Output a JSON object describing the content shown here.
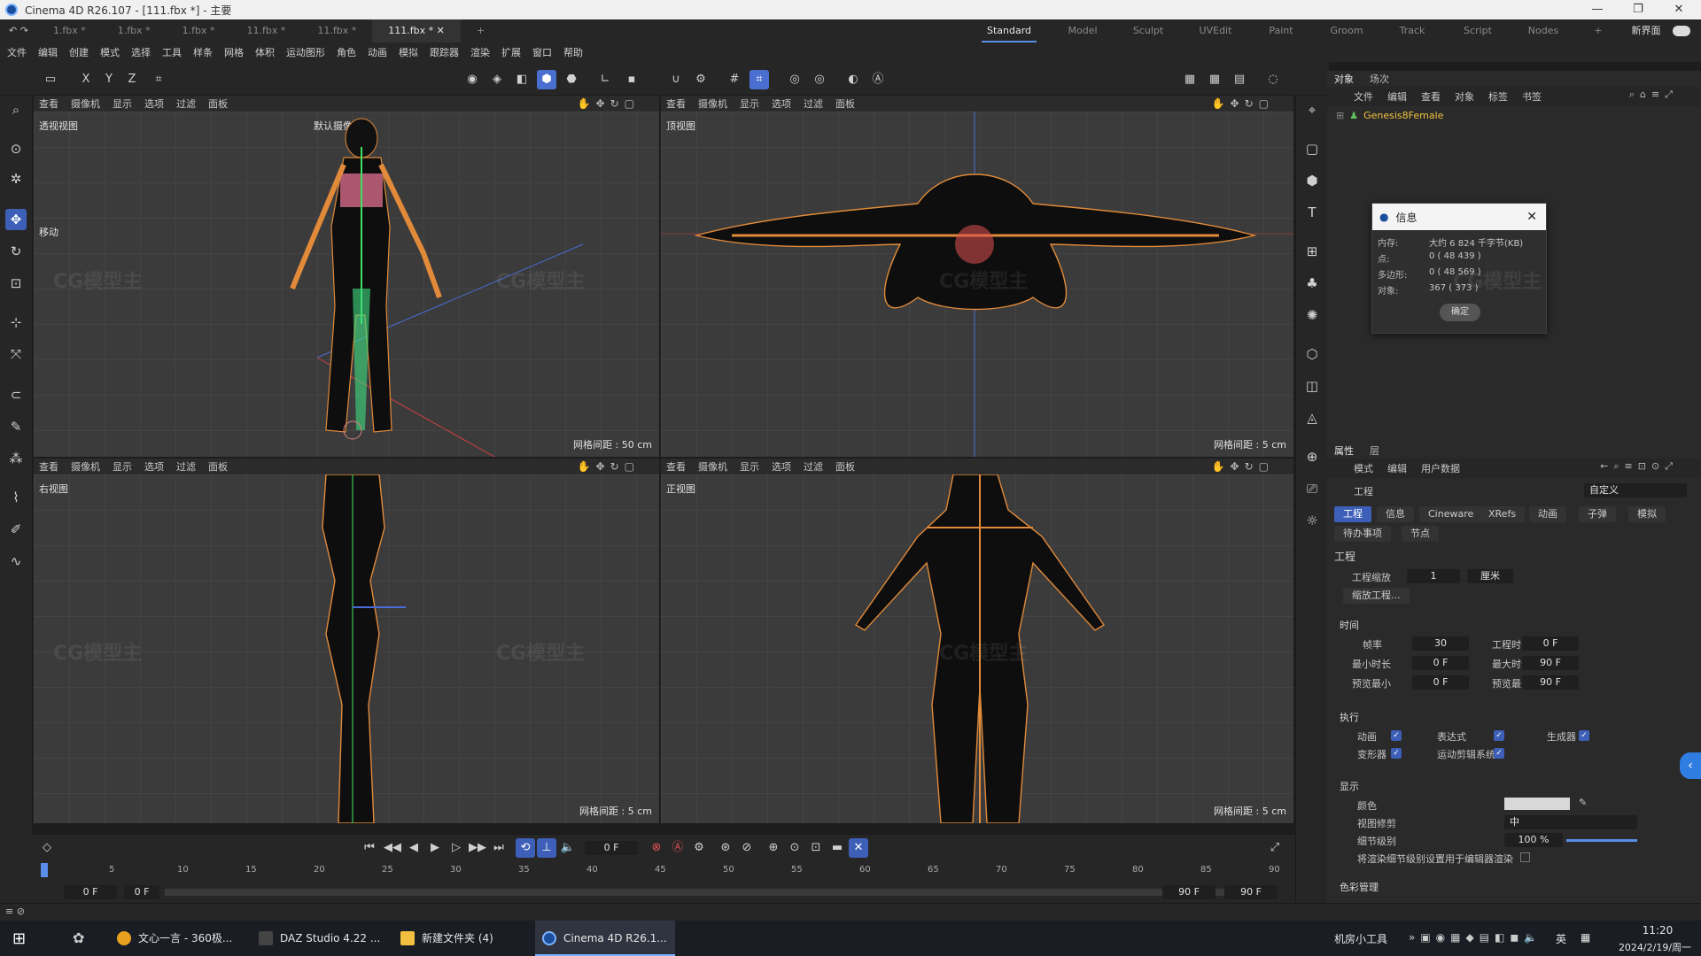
{
  "window": {
    "title": "Cinema 4D R26.107 - [111.fbx *] - 主要",
    "minimize": "—",
    "maximize": "❐",
    "close": "✕"
  },
  "doc_tabs": [
    "1.fbx *",
    "1.fbx *",
    "1.fbx *",
    "11.fbx *",
    "11.fbx *",
    "111.fbx *"
  ],
  "doc_tab_close": "✕",
  "doc_tab_add": "+",
  "layouts": [
    "Standard",
    "Model",
    "Sculpt",
    "UVEdit",
    "Paint",
    "Groom",
    "Track",
    "Script",
    "Nodes"
  ],
  "layouts_add": "+",
  "new_ui": "新界面",
  "menu": [
    "文件",
    "编辑",
    "创建",
    "模式",
    "选择",
    "工具",
    "样条",
    "网格",
    "体积",
    "运动图形",
    "角色",
    "动画",
    "模拟",
    "跟踪器",
    "渲染",
    "扩展",
    "窗口",
    "帮助"
  ],
  "axis_buttons": [
    "X",
    "Y",
    "Z"
  ],
  "viewport_menu": [
    "查看",
    "摄像机",
    "显示",
    "选项",
    "过滤",
    "面板"
  ],
  "viewports": [
    {
      "name": "透视视图",
      "camera": "默认摄像机",
      "grid": "网格间距 : 50 cm",
      "tool_hint": "移动"
    },
    {
      "name": "顶视图",
      "grid": "网格间距 : 5 cm"
    },
    {
      "name": "右视图",
      "grid": "网格间距 : 5 cm"
    },
    {
      "name": "正视图",
      "grid": "网格间距 : 5 cm"
    }
  ],
  "object_panel": {
    "tabs": [
      "对象",
      "场次"
    ],
    "menu": [
      "文件",
      "编辑",
      "查看",
      "对象",
      "标签",
      "书签"
    ],
    "object": "Genesis8Female"
  },
  "info_dialog": {
    "title": "信息",
    "rows": [
      {
        "k": "内存:",
        "v": "大约 6 824 千字节(KB)"
      },
      {
        "k": "点:",
        "v": "0 ( 48 439 )"
      },
      {
        "k": "多边形:",
        "v": "0 ( 48 569 )"
      },
      {
        "k": "对象:",
        "v": "367 ( 373 )"
      }
    ],
    "ok": "确定"
  },
  "attr_panel": {
    "tabs": [
      "属性",
      "层"
    ],
    "menu": [
      "模式",
      "编辑",
      "用户数据"
    ],
    "mode": "工程",
    "preset": "自定义",
    "chips": [
      "工程",
      "信息",
      "Cineware",
      "XRefs",
      "动画",
      "子弹",
      "模拟"
    ],
    "chips2": [
      "待办事项",
      "节点"
    ],
    "section_title": "工程",
    "scale_label": "工程缩放",
    "scale_value": "1",
    "scale_unit": "厘米",
    "scale_btn": "缩放工程...",
    "time_section": "时间",
    "time": [
      {
        "k": "帧率",
        "v": "30"
      },
      {
        "k": "工程时长",
        "v": "0 F"
      },
      {
        "k": "最小时长",
        "v": "0 F"
      },
      {
        "k": "最大时长",
        "v": "90 F"
      },
      {
        "k": "预览最小",
        "v": "0 F"
      },
      {
        "k": "预览最大",
        "v": "90 F"
      }
    ],
    "exec_section": "执行",
    "exec": [
      "动画",
      "表达式",
      "生成器",
      "变形器",
      "运动剪辑系统"
    ],
    "display_section": "显示",
    "color_label": "颜色",
    "clip_label": "视图修剪",
    "clip_value": "中",
    "lod_label": "细节级别",
    "lod_value": "100 %",
    "lod_note": "将渲染细节级别设置用于编辑器渲染",
    "color_mgmt": "色彩管理"
  },
  "timeline": {
    "frame": "0 F",
    "ticks": [
      "0",
      "5",
      "10",
      "15",
      "20",
      "25",
      "30",
      "35",
      "40",
      "45",
      "50",
      "55",
      "60",
      "65",
      "70",
      "75",
      "80",
      "85",
      "90"
    ],
    "start": "0 F",
    "start2": "0 F",
    "end": "90 F",
    "end2": "90 F"
  },
  "taskbar": {
    "apps": [
      "文心一言 - 360极...",
      "DAZ Studio 4.22 ...",
      "新建文件夹 (4)",
      "Cinema 4D R26.1..."
    ],
    "tray_label": "机房小工具",
    "ime": "英",
    "time": "11:20",
    "date": "2024/2/19/周一"
  },
  "watermark": "CG模型主",
  "colors": {
    "accent": "#3d5fb7",
    "bone": "#f08a3a",
    "viewport": "#3a3a3a"
  }
}
